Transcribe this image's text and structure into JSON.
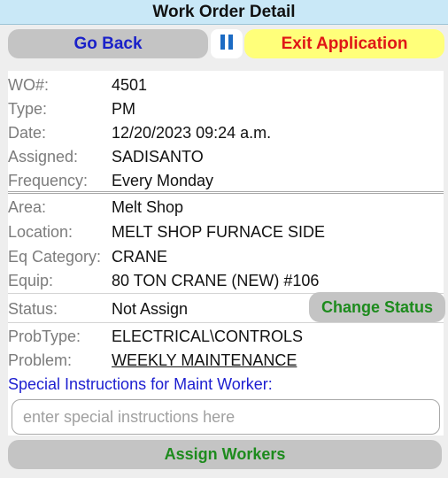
{
  "header": {
    "title": "Work Order Detail"
  },
  "toolbar": {
    "back_label": "Go Back",
    "exit_label": "Exit Application"
  },
  "fields": {
    "wo": {
      "label": "WO#:",
      "value": "4501"
    },
    "type": {
      "label": "Type:",
      "value": "PM"
    },
    "date": {
      "label": "Date:",
      "value": "12/20/2023 09:24 a.m."
    },
    "assigned": {
      "label": "Assigned:",
      "value": "SADISANTO"
    },
    "frequency": {
      "label": "Frequency:",
      "value": "Every Monday"
    },
    "area": {
      "label": "Area:",
      "value": "Melt Shop"
    },
    "location": {
      "label": "Location:",
      "value": "MELT SHOP FURNACE SIDE"
    },
    "eq_category": {
      "label": "Eq Category:",
      "value": "CRANE"
    },
    "equip": {
      "label": "Equip:",
      "value": "80 TON CRANE (NEW) #106"
    },
    "status": {
      "label": "Status:",
      "value": "Not Assign"
    },
    "prob_type": {
      "label": "ProbType:",
      "value": "ELECTRICAL\\CONTROLS"
    },
    "problem": {
      "label": "Problem:",
      "value": "WEEKLY MAINTENANCE"
    }
  },
  "status_button": {
    "label": "Change Status"
  },
  "special_instructions": {
    "label": "Special Instructions for Maint Worker:",
    "placeholder": "enter special instructions here",
    "value": ""
  },
  "assign_button": {
    "label": "Assign Workers"
  },
  "colors": {
    "header_bg": "#c9e8f7",
    "exit_bg": "#ffff7a",
    "exit_text": "#e01616",
    "back_text": "#1a21c9",
    "green_text": "#1d8b1d",
    "link_color": "#8a4a1c"
  },
  "icons": {
    "pause": "pause-icon"
  }
}
